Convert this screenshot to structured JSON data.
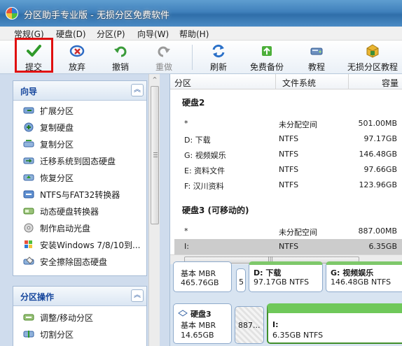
{
  "window": {
    "title": "分区助手专业版 - 无损分区免费软件"
  },
  "menu": [
    "常规(G)",
    "硬盘(D)",
    "分区(P)",
    "向导(W)",
    "帮助(H)"
  ],
  "toolbar": {
    "commit": "提交",
    "discard": "放弃",
    "undo": "撤销",
    "redo": "重做",
    "refresh": "刷新",
    "backup": "免费备份",
    "tutorial": "教程",
    "lossless": "无损分区教程"
  },
  "wizard": {
    "title": "向导",
    "items": [
      {
        "label": "扩展分区",
        "icon": "extend-partition-icon"
      },
      {
        "label": "复制硬盘",
        "icon": "copy-disk-icon"
      },
      {
        "label": "复制分区",
        "icon": "copy-partition-icon"
      },
      {
        "label": "迁移系统到固态硬盘",
        "icon": "migrate-os-icon"
      },
      {
        "label": "恢复分区",
        "icon": "recover-partition-icon"
      },
      {
        "label": "NTFS与FAT32转换器",
        "icon": "ntfs-fat32-icon"
      },
      {
        "label": "动态硬盘转换器",
        "icon": "dynamic-disk-icon"
      },
      {
        "label": "制作启动光盘",
        "icon": "bootable-cd-icon"
      },
      {
        "label": "安装Windows 7/8/10到...",
        "icon": "windows-icon"
      },
      {
        "label": "安全擦除固态硬盘",
        "icon": "secure-erase-icon"
      }
    ]
  },
  "partition_ops": {
    "title": "分区操作",
    "items": [
      {
        "label": "调整/移动分区",
        "icon": "resize-partition-icon"
      },
      {
        "label": "切割分区",
        "icon": "split-partition-icon"
      }
    ]
  },
  "columns": {
    "partition": "分区",
    "filesystem": "文件系统",
    "capacity": "容量"
  },
  "disk2": {
    "title": "硬盘2",
    "rows": [
      {
        "name": "*",
        "fs": "未分配空间",
        "cap": "501.00MB"
      },
      {
        "name": "D: 下载",
        "fs": "NTFS",
        "cap": "97.17GB"
      },
      {
        "name": "G: 视频娱乐",
        "fs": "NTFS",
        "cap": "146.48GB"
      },
      {
        "name": "E: 资料文件",
        "fs": "NTFS",
        "cap": "97.66GB"
      },
      {
        "name": "F: 汉川资料",
        "fs": "NTFS",
        "cap": "123.96GB"
      }
    ]
  },
  "disk3": {
    "title": "硬盘3 (可移动的)",
    "rows": [
      {
        "name": "*",
        "fs": "未分配空间",
        "cap": "887.00MB"
      },
      {
        "name": "I:",
        "fs": "NTFS",
        "cap": "6.35GB"
      }
    ]
  },
  "diskmap": {
    "disk2": {
      "type": "基本 MBR",
      "size": "465.76GB",
      "small": "5",
      "d_label": "D: 下载",
      "d_size": "97.17GB NTFS",
      "g_label": "G: 视频娱乐",
      "g_size": "146.48GB NTFS"
    },
    "disk3": {
      "name": "硬盘3",
      "type": "基本 MBR",
      "size": "14.65GB",
      "unalloc": "887...",
      "i_label": "I:",
      "i_size": "6.35GB NTFS"
    }
  },
  "scroll": {
    "left_arrow": "^",
    "hscroll_grip": "|||"
  }
}
